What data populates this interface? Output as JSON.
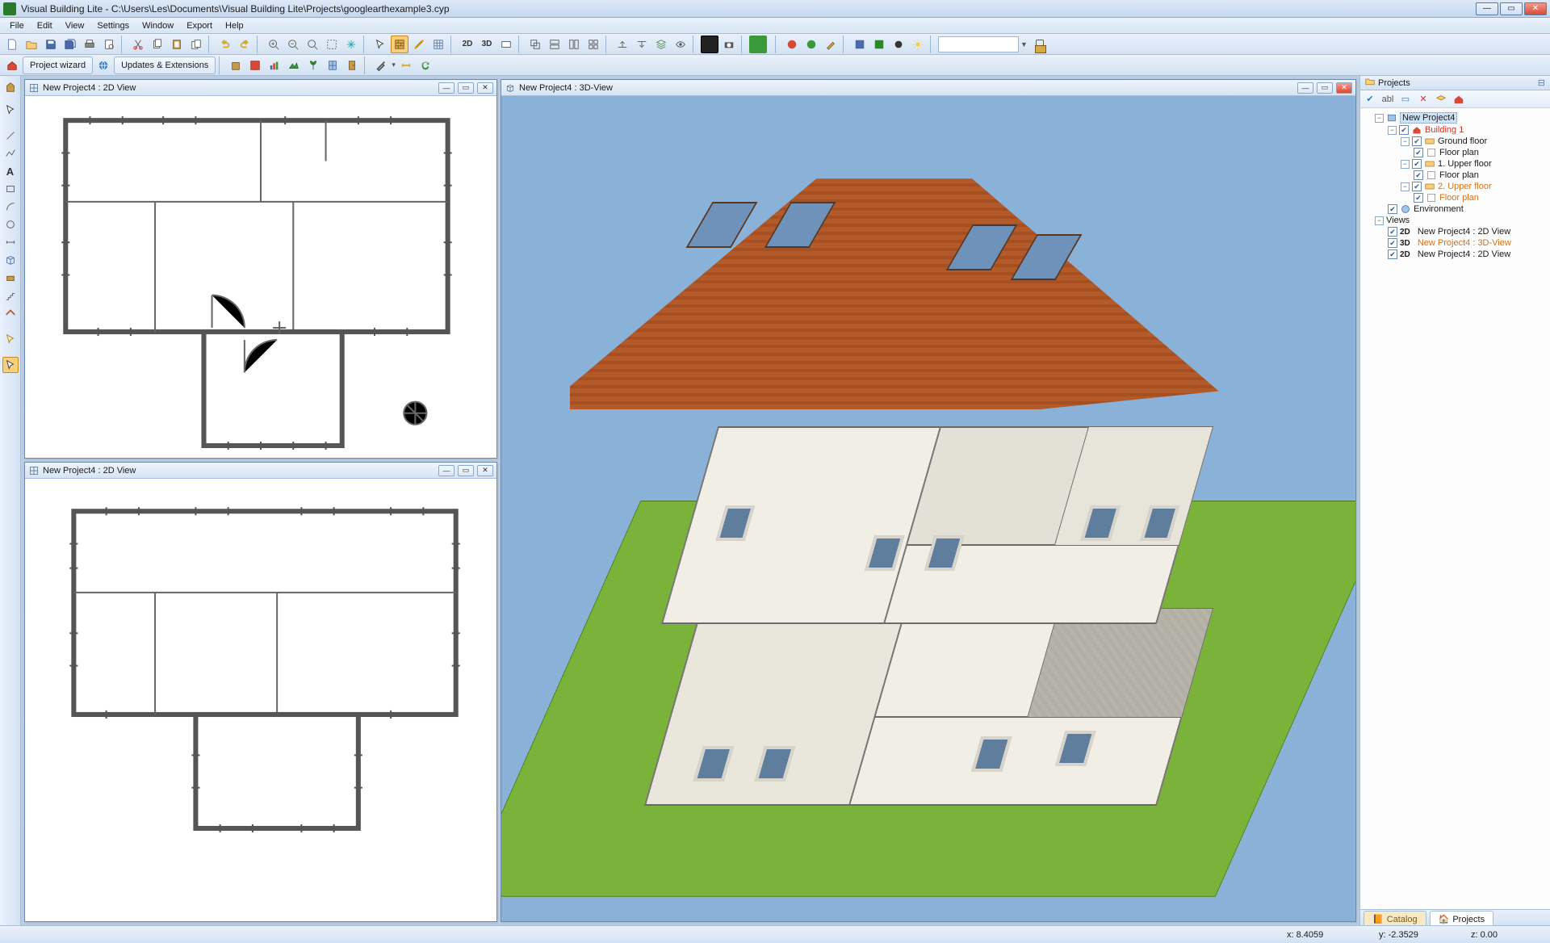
{
  "title": "Visual Building Lite - C:\\Users\\Les\\Documents\\Visual Building Lite\\Projects\\googlearthexample3.cyp",
  "menu": [
    "File",
    "Edit",
    "View",
    "Settings",
    "Window",
    "Export",
    "Help"
  ],
  "toolbar2": {
    "project_wizard": "Project wizard",
    "updates": "Updates & Extensions"
  },
  "panel2d_top": {
    "title": "New Project4 : 2D View"
  },
  "panel2d_bottom": {
    "title": "New Project4 : 2D View"
  },
  "panel3d": {
    "title": "New Project4 : 3D-View"
  },
  "side": {
    "title": "Projects",
    "root": "New Project4",
    "building": "Building 1",
    "ground": "Ground floor",
    "floorplan": "Floor plan",
    "upper1": "1. Upper floor",
    "upper2": "2. Upper floor",
    "environment": "Environment",
    "views": "Views",
    "view2d_a": "New Project4 : 2D View",
    "view3d": "New Project4 : 3D-View",
    "view2d_b": "New Project4 : 2D View",
    "tab_catalog": "Catalog",
    "tab_projects": "Projects"
  },
  "status": {
    "x": "x: 8.4059",
    "y": "y: -2.3529",
    "z": "z: 0.00"
  }
}
